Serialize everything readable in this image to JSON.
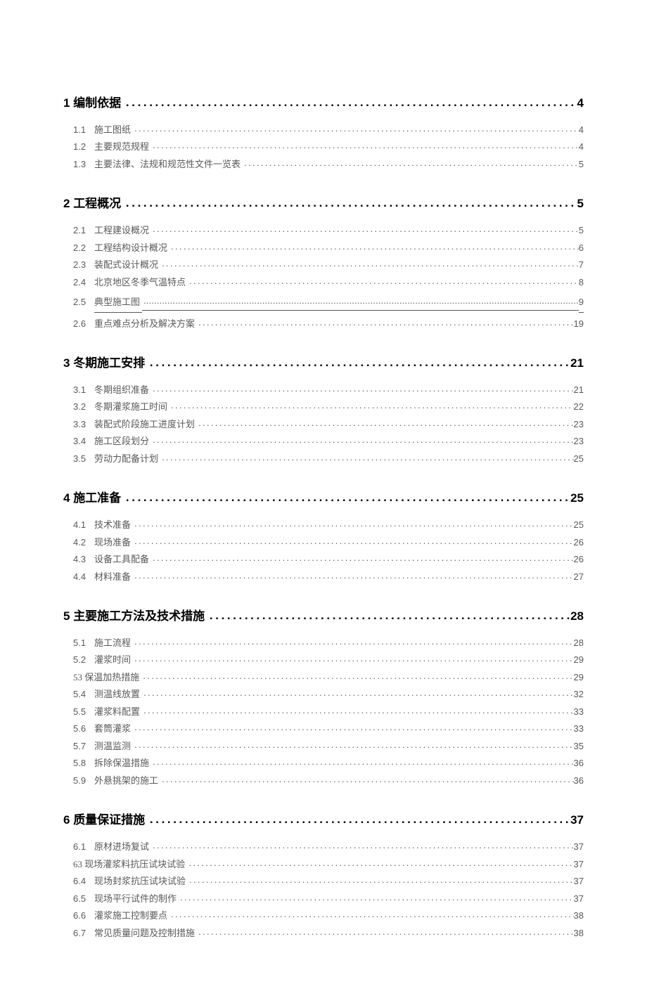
{
  "toc": [
    {
      "num": "1",
      "title": "编制依据",
      "page": "4",
      "children": [
        {
          "num": "1.1",
          "title": "施工图纸",
          "page": "4"
        },
        {
          "num": "1.2",
          "title": "主要规范规程",
          "page": "4"
        },
        {
          "num": "1.3",
          "title": "主要法律、法规和规范性文件一览表",
          "page": "5"
        }
      ]
    },
    {
      "num": "2",
      "title": "工程概况",
      "page": "5",
      "children": [
        {
          "num": "2.1",
          "title": "工程建设概况",
          "page": "5"
        },
        {
          "num": "2.2",
          "title": "工程结构设计概况",
          "page": "6"
        },
        {
          "num": "2.3",
          "title": "装配式设计概况",
          "page": "7"
        },
        {
          "num": "2.4",
          "title": "北京地区冬季气温特点",
          "page": "8"
        },
        {
          "num": "2.5",
          "title": "典型施工图",
          "page": "9",
          "underline": true
        },
        {
          "num": "2.6",
          "title": "重点难点分析及解决方案",
          "page": "19"
        }
      ]
    },
    {
      "num": "3",
      "title": "冬期施工安排",
      "page": "21",
      "children": [
        {
          "num": "3.1",
          "title": "冬期组织准备",
          "page": "21"
        },
        {
          "num": "3.2",
          "title": "冬期灌浆施工时间",
          "page": "22"
        },
        {
          "num": "3.3",
          "title": "装配式阶段施工进度计划",
          "page": "23"
        },
        {
          "num": "3.4",
          "title": "施工区段划分",
          "page": "23"
        },
        {
          "num": "3.5",
          "title": "劳动力配备计划",
          "page": "25"
        }
      ]
    },
    {
      "num": "4",
      "title": "施工准备",
      "page": "25",
      "children": [
        {
          "num": "4.1",
          "title": "技术准备",
          "page": "25"
        },
        {
          "num": "4.2",
          "title": "现场准备",
          "page": "26"
        },
        {
          "num": "4.3",
          "title": "设备工具配备",
          "page": "26"
        },
        {
          "num": "4.4",
          "title": "材料准备",
          "page": "27"
        }
      ]
    },
    {
      "num": "5",
      "title": "主要施工方法及技术措施",
      "page": "28",
      "children": [
        {
          "num": "5.1",
          "title": "施工流程",
          "page": "28"
        },
        {
          "num": "5.2",
          "title": "灌浆时间",
          "page": "29"
        },
        {
          "num": "",
          "title": "53 保温加热措施",
          "page": "29",
          "nonum": true
        },
        {
          "num": "5.4",
          "title": "测温线放置",
          "page": "32"
        },
        {
          "num": "5.5",
          "title": "灌浆料配置",
          "page": "33"
        },
        {
          "num": "5.6",
          "title": "套筒灌浆",
          "page": "33"
        },
        {
          "num": "5.7",
          "title": "测温监测",
          "page": "35"
        },
        {
          "num": "5.8",
          "title": "拆除保温措施",
          "page": "36"
        },
        {
          "num": "5.9",
          "title": "外悬挑架的施工",
          "page": "36"
        }
      ]
    },
    {
      "num": "6",
      "title": "质量保证措施",
      "page": "37",
      "children": [
        {
          "num": "6.1",
          "title": "原材进场复试",
          "page": "37"
        },
        {
          "num": "",
          "title": "63 现场灌浆料抗压试块试验",
          "page": "37",
          "nonum": true
        },
        {
          "num": "6.4",
          "title": "现场封浆抗压试块试验",
          "page": "37"
        },
        {
          "num": "6.5",
          "title": "现场平行试件的制作",
          "page": "37"
        },
        {
          "num": "6.6",
          "title": "灌浆施工控制要点",
          "page": "38"
        },
        {
          "num": "6.7",
          "title": "常见质量问题及控制措施",
          "page": "38"
        }
      ]
    }
  ]
}
